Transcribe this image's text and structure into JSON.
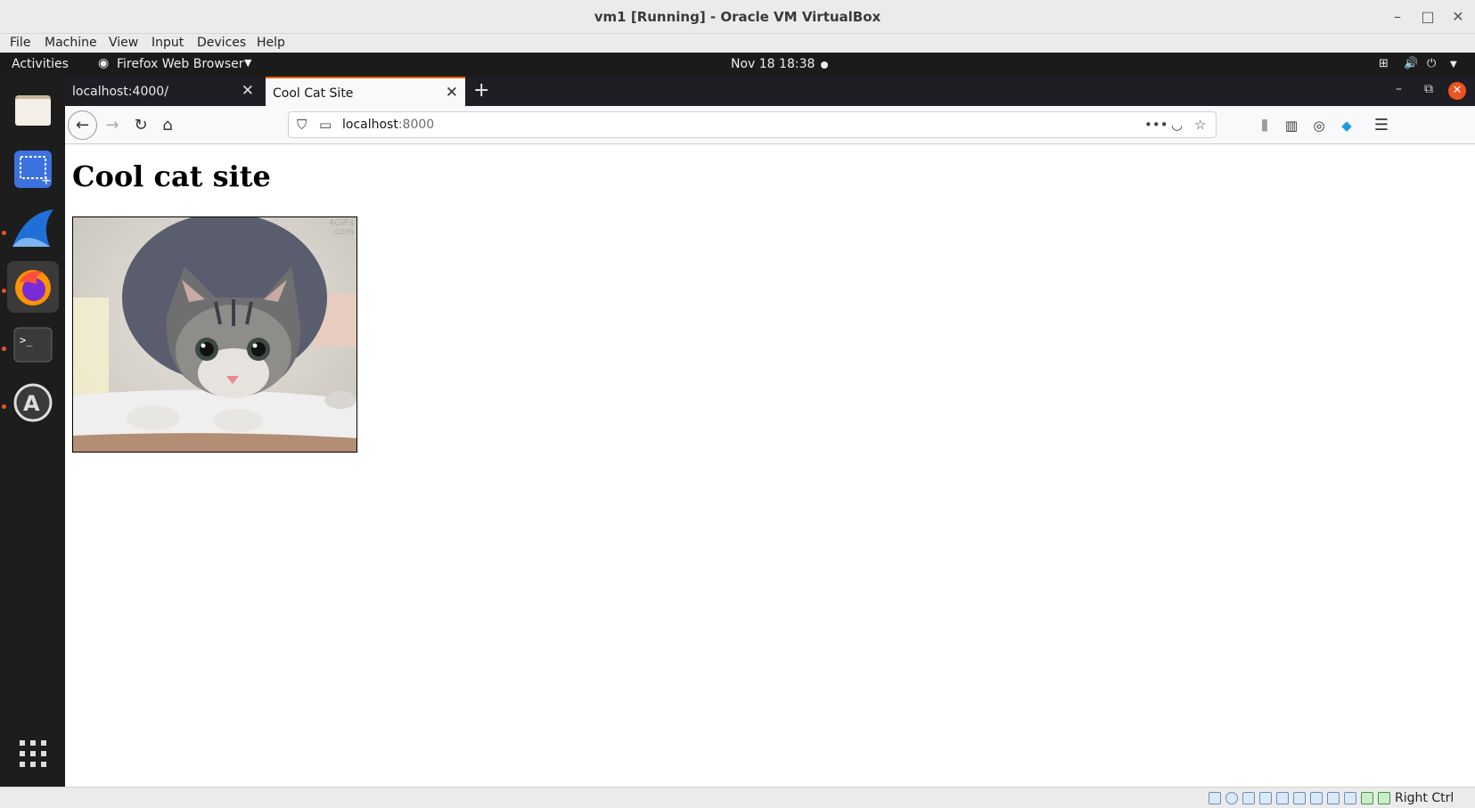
{
  "host_window": {
    "title": "vm1 [Running] - Oracle VM VirtualBox",
    "menu": [
      "File",
      "Machine",
      "View",
      "Input",
      "Devices",
      "Help"
    ],
    "status_right": "Right Ctrl"
  },
  "gnome": {
    "activities": "Activities",
    "app_menu": "Firefox Web Browser",
    "clock": "Nov 18  18:38"
  },
  "dock": [
    "files-icon",
    "screenshot-icon",
    "wireshark-icon",
    "firefox-icon",
    "terminal-icon",
    "software-updater-icon",
    "show-apps-icon"
  ],
  "browser": {
    "tabs": [
      {
        "label": "localhost:4000/",
        "active": false
      },
      {
        "label": "Cool Cat Site",
        "active": true
      }
    ],
    "url": {
      "host": "localhost",
      "port": ":8000"
    }
  },
  "page": {
    "heading": "Cool cat site",
    "image_watermark": "4GIFs\n.com"
  },
  "colors": {
    "accent": "#e95420",
    "tab_highlight": "#e66000"
  }
}
